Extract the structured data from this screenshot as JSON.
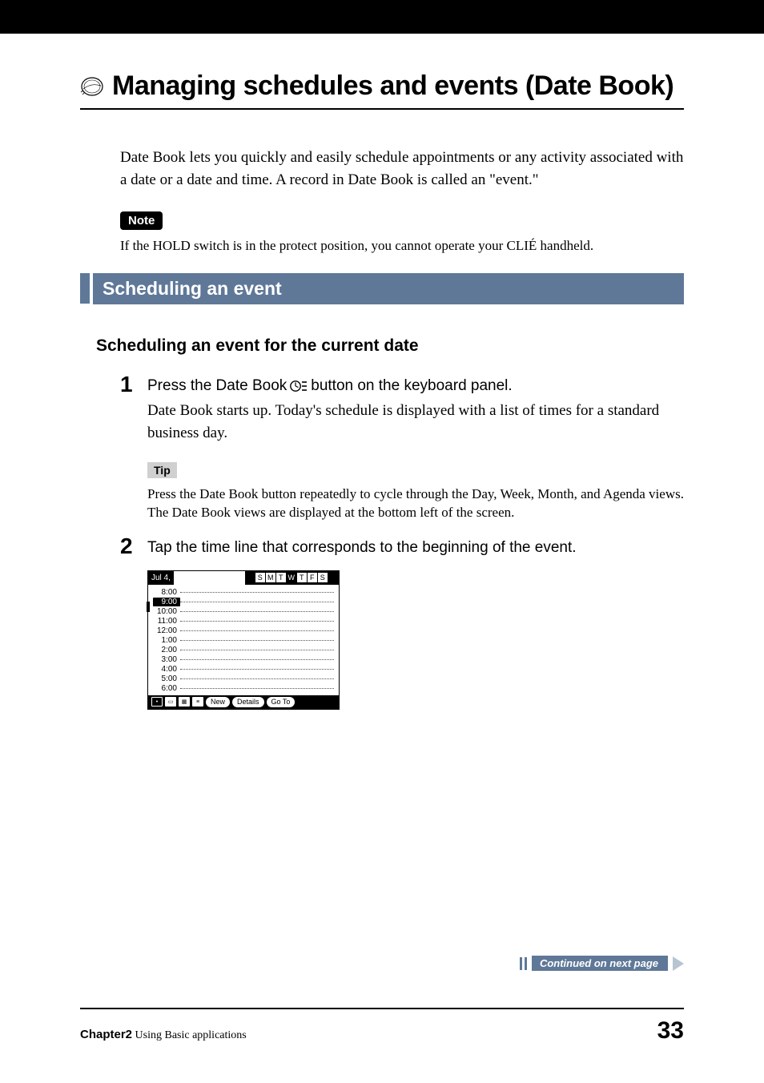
{
  "title": "Managing schedules and events (Date Book)",
  "intro": "Date Book lets you quickly and easily schedule appointments or any activity associated with a date or a date and time. A record in Date Book is called an \"event.\"",
  "note_label": "Note",
  "note_text": "If the HOLD switch is in the protect position, you cannot operate your CLIÉ handheld.",
  "section_heading": "Scheduling an event",
  "subheading": "Scheduling an event for the current date",
  "steps": [
    {
      "num": "1",
      "line_a": "Press the Date Book",
      "line_b": "button on the keyboard panel.",
      "desc": "Date Book starts up. Today's schedule is displayed with a list of times for a standard business day."
    },
    {
      "num": "2",
      "line_a": "Tap the time line that corresponds to the beginning of the event.",
      "line_b": "",
      "desc": ""
    }
  ],
  "tip_label": "Tip",
  "tip_text": "Press the Date Book button repeatedly to cycle through the Day, Week, Month, and Agenda views. The Date Book views are displayed at the bottom left of the screen.",
  "screenshot": {
    "date_label": "Jul 4,",
    "days": [
      "S",
      "M",
      "T",
      "W",
      "T",
      "F",
      "S"
    ],
    "active_day_index": 3,
    "times": [
      "8:00",
      "9:00",
      "10:00",
      "11:00",
      "12:00",
      "1:00",
      "2:00",
      "3:00",
      "4:00",
      "5:00",
      "6:00"
    ],
    "highlight_index": 1,
    "buttons": {
      "new": "New",
      "details": "Details",
      "goto": "Go To"
    }
  },
  "continued_text": "Continued on next page",
  "footer": {
    "chapter": "Chapter2",
    "chapter_title": "Using Basic applications",
    "page": "33"
  }
}
